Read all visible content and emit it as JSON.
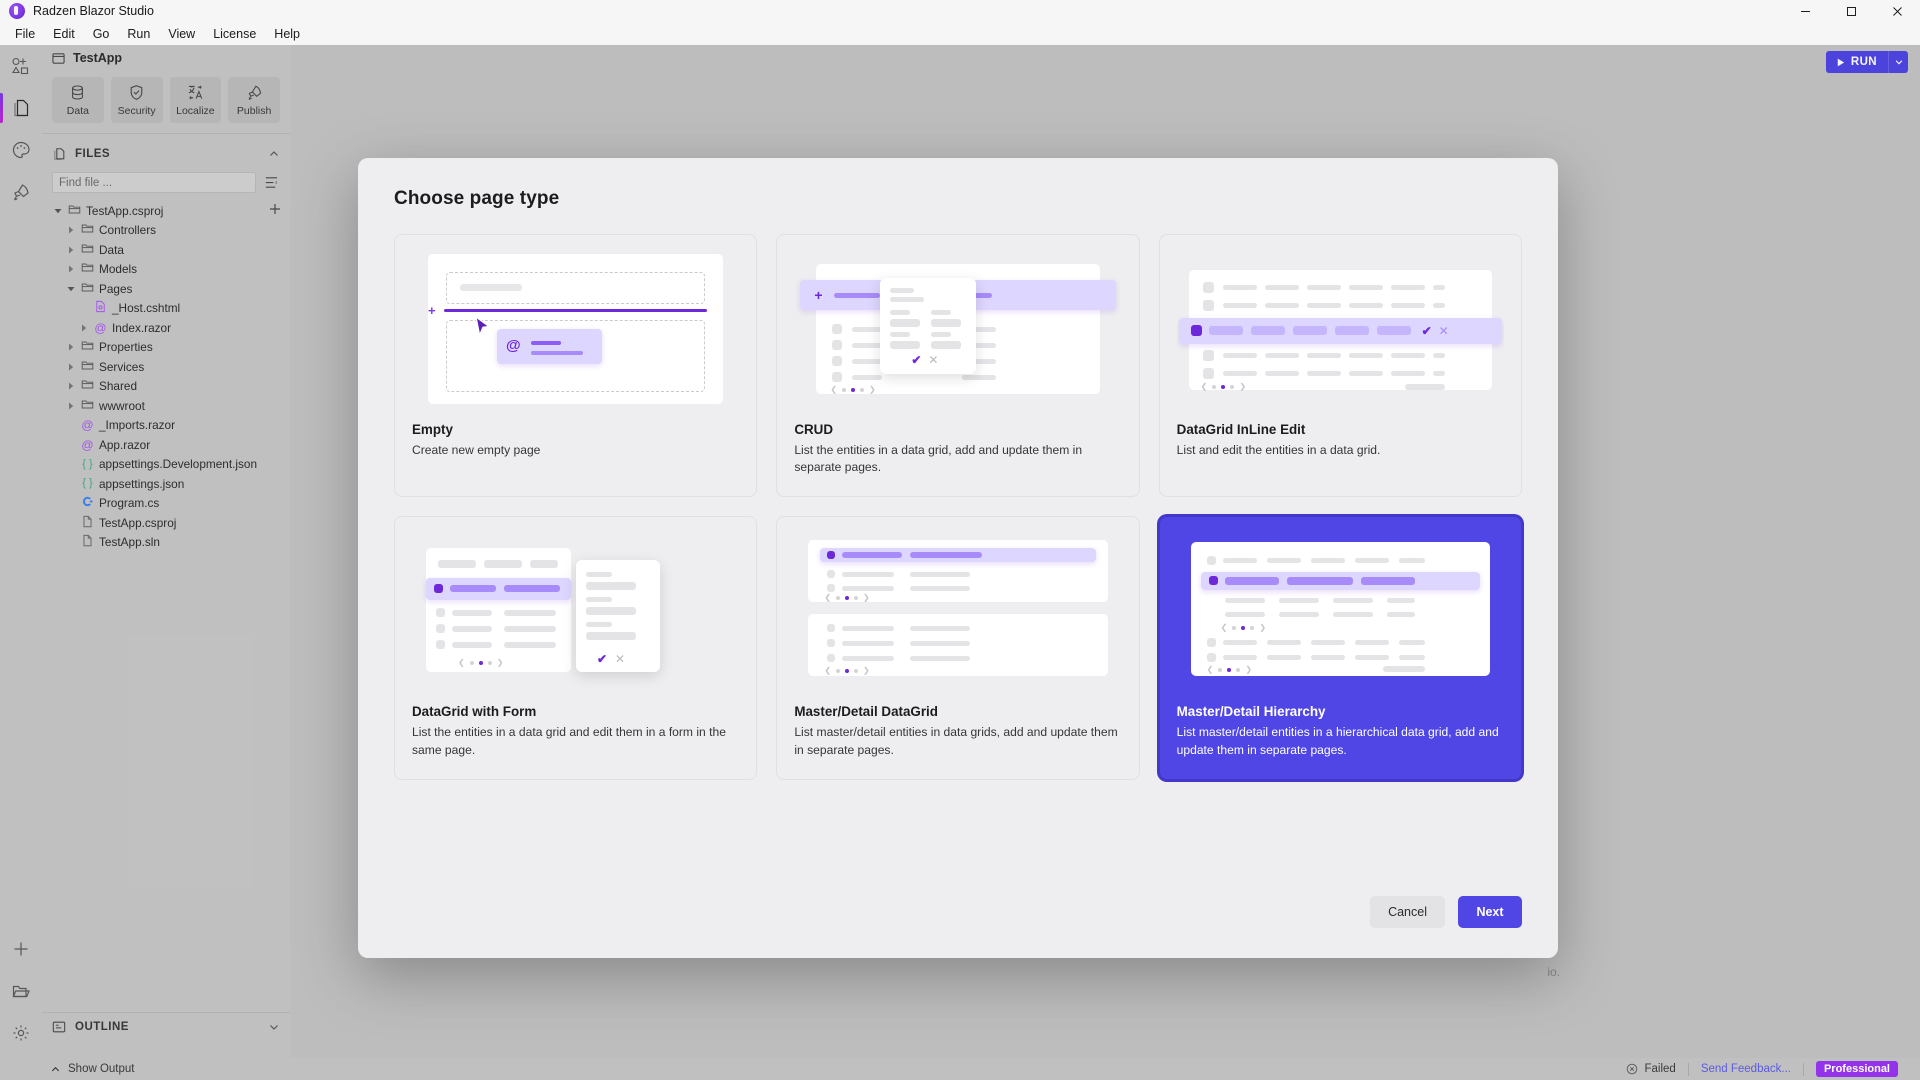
{
  "window": {
    "title": "Radzen Blazor Studio",
    "logo_icon": "radzen-logo-icon",
    "controls": [
      {
        "name": "minimize",
        "icon": "minimize-icon",
        "glyph": "—"
      },
      {
        "name": "maximize",
        "icon": "maximize-icon",
        "glyph": "❐"
      },
      {
        "name": "close",
        "icon": "close-icon",
        "glyph": "✕"
      }
    ]
  },
  "menubar": {
    "items": [
      "File",
      "Edit",
      "Go",
      "Run",
      "View",
      "License",
      "Help"
    ]
  },
  "activitybar": {
    "items": [
      {
        "name": "scaffold",
        "icon": "shapes-plus-icon",
        "active": false
      },
      {
        "name": "files",
        "icon": "files-icon",
        "active": true
      },
      {
        "name": "theme",
        "icon": "palette-icon",
        "active": false
      },
      {
        "name": "deploy",
        "icon": "rocket-icon",
        "active": false
      },
      {
        "name": "add",
        "icon": "plus-icon",
        "active": false
      },
      {
        "name": "open-folder",
        "icon": "folder-open-icon",
        "active": false
      },
      {
        "name": "settings",
        "icon": "gear-icon",
        "active": false
      }
    ]
  },
  "sidebar": {
    "project_name": "TestApp",
    "project_icon": "window-icon",
    "tools": [
      {
        "label": "Data",
        "icon": "database-icon"
      },
      {
        "label": "Security",
        "icon": "shield-check-icon"
      },
      {
        "label": "Localize",
        "icon": "translate-icon"
      },
      {
        "label": "Publish",
        "icon": "rocket-icon"
      }
    ],
    "files_section": {
      "title": "FILES",
      "icon": "files-icon",
      "collapse_icon": "chevron-up-icon",
      "search_placeholder": "Find file ...",
      "search_value": "",
      "filter_icon": "list-tree-icon",
      "add_icon": "plus-icon"
    },
    "tree": [
      {
        "label": "TestApp.csproj",
        "icon": "folder-icon",
        "indent": 0,
        "twisty": "down"
      },
      {
        "label": "Controllers",
        "icon": "folder-icon",
        "indent": 1,
        "twisty": "right"
      },
      {
        "label": "Data",
        "icon": "folder-icon",
        "indent": 1,
        "twisty": "right"
      },
      {
        "label": "Models",
        "icon": "folder-icon",
        "indent": 1,
        "twisty": "right"
      },
      {
        "label": "Pages",
        "icon": "folder-icon",
        "indent": 1,
        "twisty": "down"
      },
      {
        "label": "_Host.cshtml",
        "icon": "cshtml-file-icon",
        "indent": 2,
        "twisty": "none"
      },
      {
        "label": "Index.razor",
        "icon": "razor-at-icon",
        "indent": 2,
        "twisty": "right"
      },
      {
        "label": "Properties",
        "icon": "folder-icon",
        "indent": 1,
        "twisty": "right"
      },
      {
        "label": "Services",
        "icon": "folder-icon",
        "indent": 1,
        "twisty": "right"
      },
      {
        "label": "Shared",
        "icon": "folder-icon",
        "indent": 1,
        "twisty": "right"
      },
      {
        "label": "wwwroot",
        "icon": "folder-icon",
        "indent": 1,
        "twisty": "right"
      },
      {
        "label": "_Imports.razor",
        "icon": "razor-at-icon",
        "indent": 1,
        "twisty": "none"
      },
      {
        "label": "App.razor",
        "icon": "razor-at-icon",
        "indent": 1,
        "twisty": "none"
      },
      {
        "label": "appsettings.Development.json",
        "icon": "json-braces-icon",
        "indent": 1,
        "twisty": "none"
      },
      {
        "label": "appsettings.json",
        "icon": "json-braces-icon",
        "indent": 1,
        "twisty": "none"
      },
      {
        "label": "Program.cs",
        "icon": "csharp-icon",
        "indent": 1,
        "twisty": "none"
      },
      {
        "label": "TestApp.csproj",
        "icon": "plain-file-icon",
        "indent": 1,
        "twisty": "none"
      },
      {
        "label": "TestApp.sln",
        "icon": "plain-file-icon",
        "indent": 1,
        "twisty": "none"
      }
    ],
    "outline_section": {
      "title": "OUTLINE",
      "icon": "outline-icon",
      "collapse_icon": "chevron-down-icon"
    }
  },
  "toolbar": {
    "run_label": "RUN",
    "run_icon": "play-icon",
    "run_dropdown_icon": "chevron-down-icon"
  },
  "dialog": {
    "title": "Choose page type",
    "cards": [
      {
        "name": "Empty",
        "description": "Create new empty page",
        "selected": false,
        "art": "empty-page-art"
      },
      {
        "name": "CRUD",
        "description": "List the entities in a data grid, add and update them in separate pages.",
        "selected": false,
        "art": "crud-art"
      },
      {
        "name": "DataGrid InLine Edit",
        "description": "List and edit the entities in a data grid.",
        "selected": false,
        "art": "inline-edit-art"
      },
      {
        "name": "DataGrid with Form",
        "description": "List the entities in a data grid and edit them in a form in the same page.",
        "selected": false,
        "art": "datagrid-form-art"
      },
      {
        "name": "Master/Detail DataGrid",
        "description": "List master/detail entities in data grids, add and update them in separate pages.",
        "selected": false,
        "art": "master-detail-art"
      },
      {
        "name": "Master/Detail Hierarchy",
        "description": "List master/detail entities in a hierarchical data grid, add and update them in separate pages.",
        "selected": true,
        "art": "master-detail-hierarchy-art"
      }
    ],
    "cancel_label": "Cancel",
    "next_label": "Next"
  },
  "background": {
    "partial_text": "io."
  },
  "statusbar": {
    "show_output": "Show Output",
    "show_output_icon": "chevron-up-icon",
    "status_text": "Failed",
    "status_icon": "error-circle-icon",
    "feedback_label": "Send Feedback...",
    "license_badge": "Professional"
  },
  "colors": {
    "accent": "#4f46e5",
    "purple": "#6d28d9",
    "purple_light": "#ddd6fe",
    "badge": "#9333ea",
    "window_bg": "#c8c8c8",
    "modal_bg": "#eeeef0"
  }
}
